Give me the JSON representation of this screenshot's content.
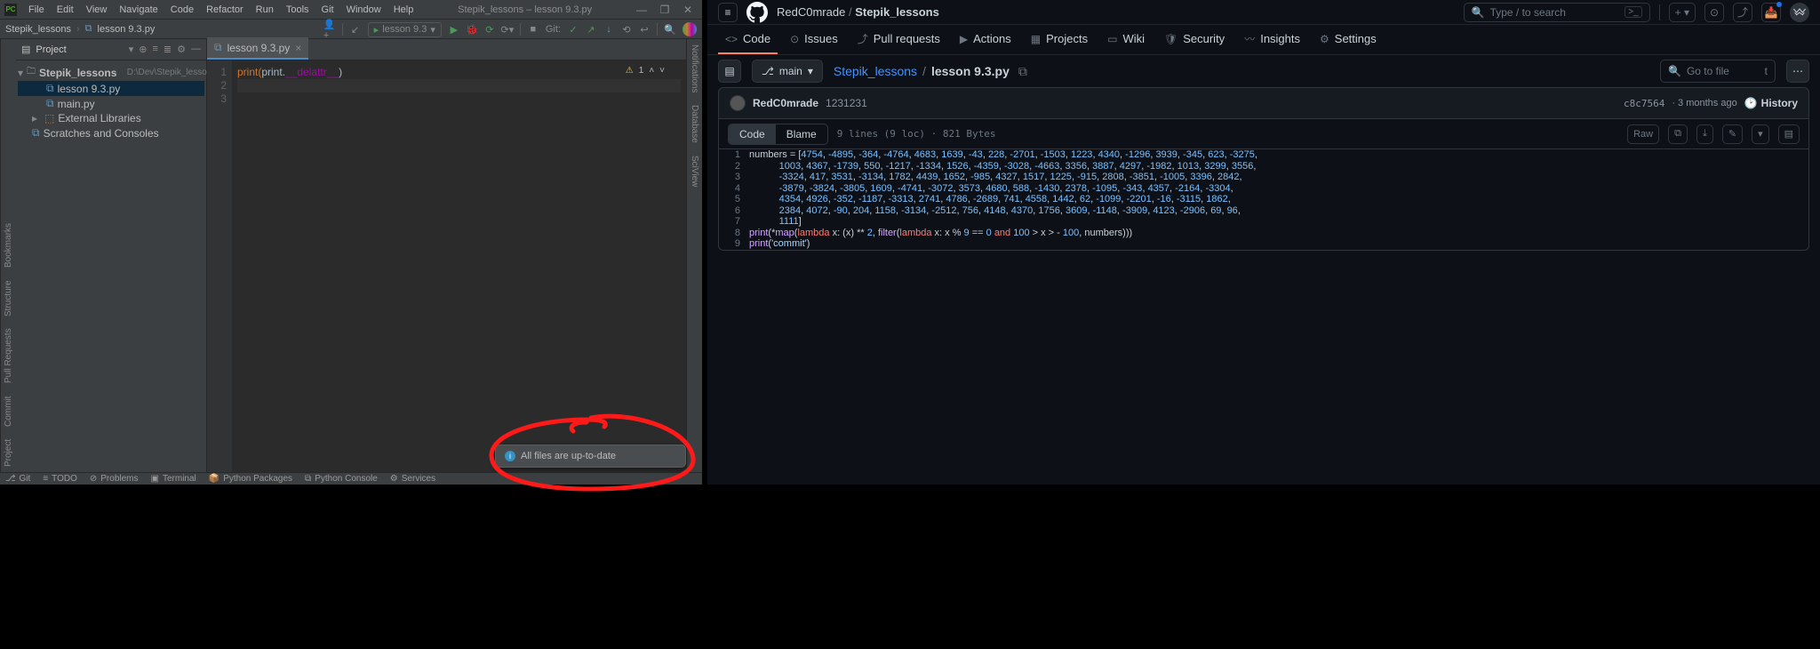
{
  "ide": {
    "menu": [
      "File",
      "Edit",
      "View",
      "Navigate",
      "Code",
      "Refactor",
      "Run",
      "Tools",
      "Git",
      "Window",
      "Help"
    ],
    "window_title": "Stepik_lessons – lesson 9.3.py",
    "crumbs": {
      "project": "Stepik_lessons",
      "file": "lesson 9.3.py"
    },
    "run_config": "lesson 9.3",
    "git_label": "Git:",
    "project_panel": {
      "title": "Project",
      "root": "Stepik_lessons",
      "root_path": "D:\\Dev\\Stepik_lessons",
      "files": [
        "lesson 9.3.py",
        "main.py"
      ],
      "external": "External Libraries",
      "scratches": "Scratches and Consoles"
    },
    "tab": "lesson 9.3.py",
    "code_lines": {
      "l1_a": "print(",
      "l1_b": "print",
      "l1_c": ".",
      "l1_d": "__delattr__",
      "l1_e": ")"
    },
    "hint_warn": "1",
    "status": {
      "git": "Git",
      "todo": "TODO",
      "problems": "Problems",
      "terminal": "Terminal",
      "packages": "Python Packages",
      "console": "Python Console",
      "services": "Services"
    },
    "side_left": {
      "project": "Project",
      "commit": "Commit",
      "pr": "Pull Requests",
      "structure": "Structure",
      "bookmarks": "Bookmarks"
    },
    "side_right": {
      "notifications": "Notifications",
      "database": "Database",
      "sciview": "SciView"
    },
    "toast": "All files are up-to-date"
  },
  "gh": {
    "owner": "RedC0mrade",
    "repo": "Stepik_lessons",
    "search_placeholder": "Type / to search",
    "nav": [
      {
        "icon": "<>",
        "label": "Code",
        "active": true
      },
      {
        "icon": "⊙",
        "label": "Issues"
      },
      {
        "icon": "⤴",
        "label": "Pull requests"
      },
      {
        "icon": "▶",
        "label": "Actions"
      },
      {
        "icon": "▦",
        "label": "Projects"
      },
      {
        "icon": "▭",
        "label": "Wiki"
      },
      {
        "icon": "🛡",
        "label": "Security"
      },
      {
        "icon": "〰",
        "label": "Insights"
      },
      {
        "icon": "⚙",
        "label": "Settings"
      }
    ],
    "branch": "main",
    "bc_repo": "Stepik_lessons",
    "bc_file": "lesson 9.3.py",
    "find_placeholder": "Go to file",
    "find_kbd": "t",
    "commit": {
      "author": "RedC0mrade",
      "message": "1231231",
      "sha": "c8c7564",
      "age": "3 months ago",
      "history": "History"
    },
    "file_meta": "9 lines (9 loc) · 821 Bytes",
    "seg_code": "Code",
    "seg_blame": "Blame",
    "raw": "Raw",
    "lines": [
      {
        "n": "1",
        "t": "numbers = [<n>4754</n>, <n>-4895</n>, <n>-364</n>, <n>-4764</n>, <n>4683</n>, <n>1639</n>, <n>-43</n>, <n>228</n>, <n>-2701</n>, <n>-1503</n>, <n>1223</n>, <n>4340</n>, <n>-1296</n>, <n>3939</n>, <n>-345</n>, <n>623</n>, <n>-3275</n>,"
      },
      {
        "n": "2",
        "t": "           <n>1003</n>, <n>4367</n>, <n>-1739</n>, <n>550</n>, <n>-1217</n>, <n>-1334</n>, <n>1526</n>, <n>-4359</n>, <n>-3028</n>, <n>-4663</n>, <n>3356</n>, <n>3887</n>, <n>4297</n>, <n>-1982</n>, <n>1013</n>, <n>3299</n>, <n>3556</n>,"
      },
      {
        "n": "3",
        "t": "           <n>-3324</n>, <n>417</n>, <n>3531</n>, <n>-3134</n>, <n>1782</n>, <n>4439</n>, <n>1652</n>, <n>-985</n>, <n>4327</n>, <n>1517</n>, <n>1225</n>, <n>-915</n>, <n>2808</n>, <n>-3851</n>, <n>-1005</n>, <n>3396</n>, <n>2842</n>,"
      },
      {
        "n": "4",
        "t": "           <n>-3879</n>, <n>-3824</n>, <n>-3805</n>, <n>1609</n>, <n>-4741</n>, <n>-3072</n>, <n>3573</n>, <n>4680</n>, <n>588</n>, <n>-1430</n>, <n>2378</n>, <n>-1095</n>, <n>-343</n>, <n>4357</n>, <n>-2164</n>, <n>-3304</n>,"
      },
      {
        "n": "5",
        "t": "           <n>4354</n>, <n>4926</n>, <n>-352</n>, <n>-1187</n>, <n>-3313</n>, <n>2741</n>, <n>4786</n>, <n>-2689</n>, <n>741</n>, <n>4558</n>, <n>1442</n>, <n>62</n>, <n>-1099</n>, <n>-2201</n>, <n>-16</n>, <n>-3115</n>, <n>1862</n>,"
      },
      {
        "n": "6",
        "t": "           <n>2384</n>, <n>4072</n>, <n>-90</n>, <n>204</n>, <n>1158</n>, <n>-3134</n>, <n>-2512</n>, <n>756</n>, <n>4148</n>, <n>4370</n>, <n>1756</n>, <n>3609</n>, <n>-1148</n>, <n>-3909</n>, <n>4123</n>, <n>-2906</n>, <n>69</n>, <n>96</n>,"
      },
      {
        "n": "7",
        "t": "           <n>1111</n>]"
      },
      {
        "n": "8",
        "t": "<f>print</f>(*<f>map</f>(<k>lambda</k> x: (x) ** <n>2</n>, <f>filter</f>(<k>lambda</k> x: x % <n>9</n> == <n>0</n> <k>and</k> <n>100</n> > x > - <n>100</n>, numbers)))"
      },
      {
        "n": "9",
        "t": "<f>print</f>(<s>'commit'</s>)"
      }
    ]
  }
}
